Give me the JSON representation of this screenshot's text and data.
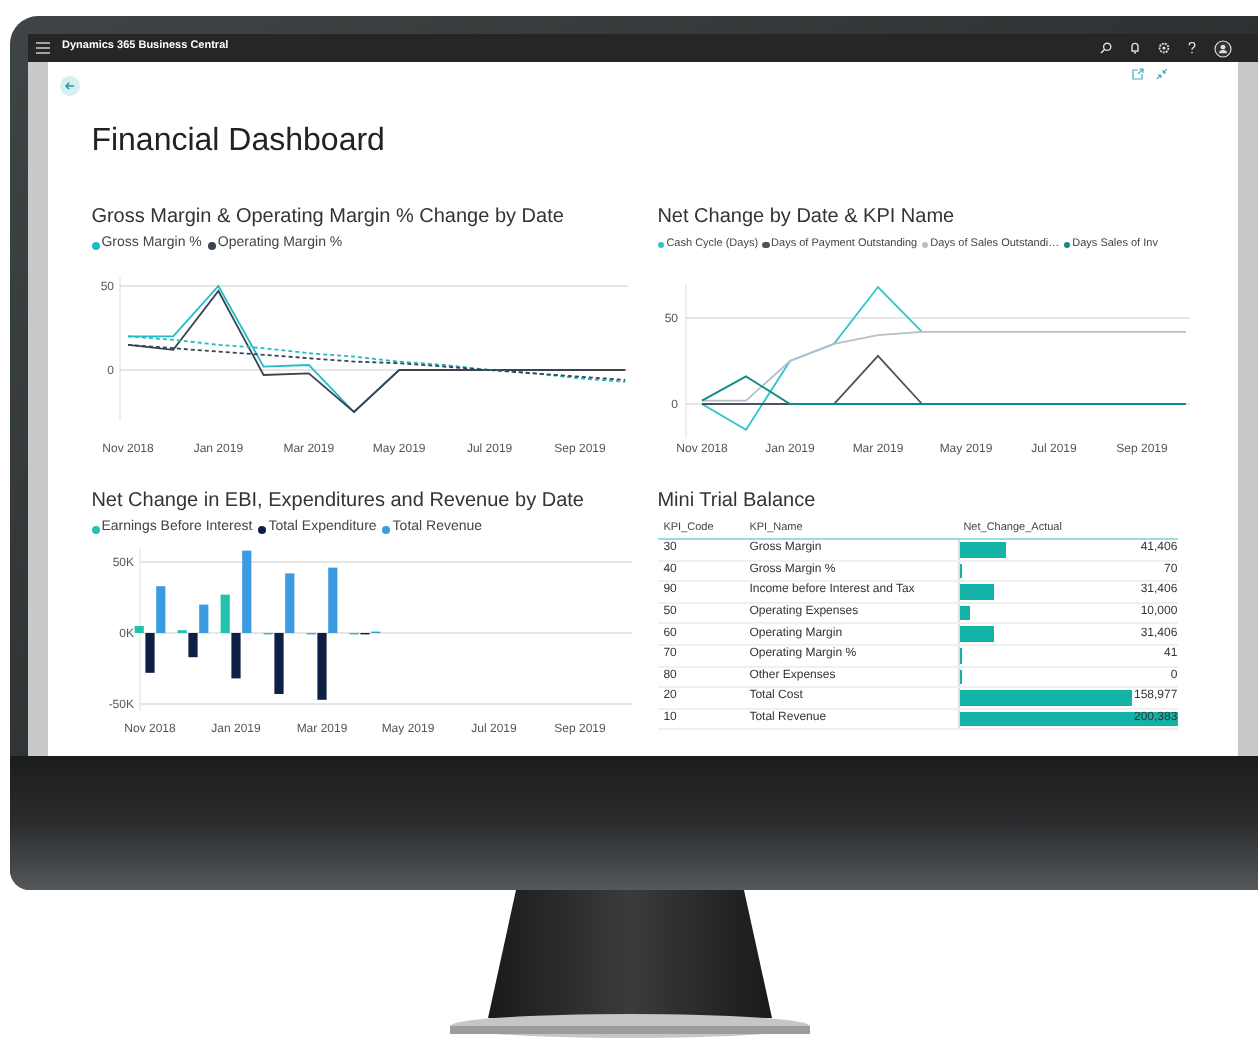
{
  "app_bar": {
    "title": "Dynamics 365 Business Central"
  },
  "page": {
    "title": "Financial Dashboard"
  },
  "margin_chart": {
    "chart_data": {
      "type": "line",
      "title": "Gross Margin & Operating Margin % Change by Date",
      "categories": [
        "Nov 2018",
        null,
        "Jan 2019",
        null,
        "Mar 2019",
        null,
        "May 2019",
        null,
        "Jul 2019",
        null,
        "Sep 2019",
        null
      ],
      "grid": true,
      "ylim": [
        -30,
        55
      ],
      "series": [
        {
          "name": "Gross Margin %",
          "color": "#1fbcc8",
          "values": [
            20,
            20,
            50,
            2,
            3,
            -25,
            0,
            0,
            0,
            0,
            0,
            0
          ]
        },
        {
          "name": "Operating Margin %",
          "color": "#3a4350",
          "values": [
            15,
            12,
            47,
            -3,
            -2,
            -25,
            0,
            0,
            0,
            0,
            0,
            0
          ]
        },
        {
          "line_style": "dashed",
          "color": "#1fbcc8",
          "values": [
            20,
            18,
            15,
            13,
            10,
            8,
            5,
            3,
            0,
            -2,
            -5,
            -7
          ]
        },
        {
          "line_style": "dashed",
          "color": "#3a4350",
          "values": [
            15,
            13,
            11,
            9,
            7,
            5,
            4,
            2,
            0,
            -2,
            -4,
            -6
          ]
        }
      ],
      "yticks": [
        {
          "value": 0,
          "label": "0"
        },
        {
          "value": 50,
          "label": "50"
        }
      ]
    }
  },
  "kpi_chart": {
    "chart_data": {
      "type": "line",
      "title": "Net Change by Date & KPI Name",
      "categories": [
        "Nov 2018",
        null,
        "Jan 2019",
        null,
        "Mar 2019",
        null,
        "May 2019",
        null,
        "Jul 2019",
        null,
        "Sep 2019",
        null
      ],
      "grid": true,
      "ylim": [
        -20,
        70
      ],
      "series": [
        {
          "name": "Cash Cycle (Days)",
          "color": "#2ec4cc",
          "values": [
            0,
            -15,
            25,
            35,
            68,
            42,
            null,
            null,
            null,
            null,
            null,
            null
          ]
        },
        {
          "name": "Days of Payment Outstanding",
          "color": "#4a5260",
          "values": [
            0,
            0,
            0,
            0,
            28,
            0,
            null,
            null,
            null,
            null,
            null,
            null
          ]
        },
        {
          "name": "Days of Sales Outstandi…",
          "color": "#b8bec7",
          "values": [
            2,
            2,
            25,
            35,
            40,
            42,
            42,
            42,
            42,
            42,
            42,
            42
          ]
        },
        {
          "name": "Days Sales of Inv",
          "color": "#0f8a8a",
          "values": [
            2,
            16,
            0,
            0,
            0,
            0,
            0,
            0,
            0,
            0,
            0,
            0
          ]
        }
      ],
      "yticks": [
        {
          "value": 0,
          "label": "0"
        },
        {
          "value": 50,
          "label": "50"
        }
      ]
    }
  },
  "ebi_chart": {
    "chart_data": {
      "type": "bar",
      "title": "Net Change in EBI, Expenditures and Revenue by Date",
      "categories": [
        "Nov 2018",
        null,
        "Jan 2019",
        null,
        "Mar 2019",
        null,
        "May 2019",
        null,
        "Jul 2019",
        null,
        "Sep 2019",
        null
      ],
      "grid": true,
      "ylim": [
        -55,
        60
      ],
      "series": [
        {
          "name": "Earnings Before Interest",
          "color": "#22c2ad",
          "values": [
            5,
            2,
            27,
            -1,
            -1,
            -1,
            null,
            null,
            null,
            null,
            null,
            null
          ]
        },
        {
          "name": "Total Expenditure",
          "color": "#0d1f44",
          "values": [
            -28,
            -17,
            -32,
            -43,
            -47,
            -1,
            null,
            null,
            null,
            null,
            null,
            null
          ]
        },
        {
          "name": "Total Revenue",
          "color": "#3b9be0",
          "values": [
            33,
            20,
            58,
            42,
            46,
            1,
            null,
            null,
            null,
            null,
            null,
            null
          ]
        }
      ],
      "yticks": [
        {
          "value": -50,
          "label": "-50K"
        },
        {
          "value": 0,
          "label": "0K"
        },
        {
          "value": 50,
          "label": "50K"
        }
      ]
    }
  },
  "trial_balance": {
    "title": "Mini Trial Balance",
    "columns": [
      "KPI_Code",
      "KPI_Name",
      "Net_Change_Actual"
    ],
    "rows": [
      {
        "code": "30",
        "name": "Gross Margin",
        "value": "41,406",
        "level": 0.21
      },
      {
        "code": "40",
        "name": "Gross Margin %",
        "value": "70",
        "level": 0.005
      },
      {
        "code": "90",
        "name": "Income before Interest and Tax",
        "value": "31,406",
        "level": 0.16
      },
      {
        "code": "50",
        "name": "Operating Expenses",
        "value": "10,000",
        "level": 0.05
      },
      {
        "code": "60",
        "name": "Operating Margin",
        "value": "31,406",
        "level": 0.16
      },
      {
        "code": "70",
        "name": "Operating Margin %",
        "value": "41",
        "level": 0.004
      },
      {
        "code": "80",
        "name": "Other Expenses",
        "value": "0",
        "level": 0
      },
      {
        "code": "20",
        "name": "Total Cost",
        "value": "158,977",
        "level": 0.79
      },
      {
        "code": "10",
        "name": "Total Revenue",
        "value": "200,383",
        "level": 1
      }
    ]
  }
}
